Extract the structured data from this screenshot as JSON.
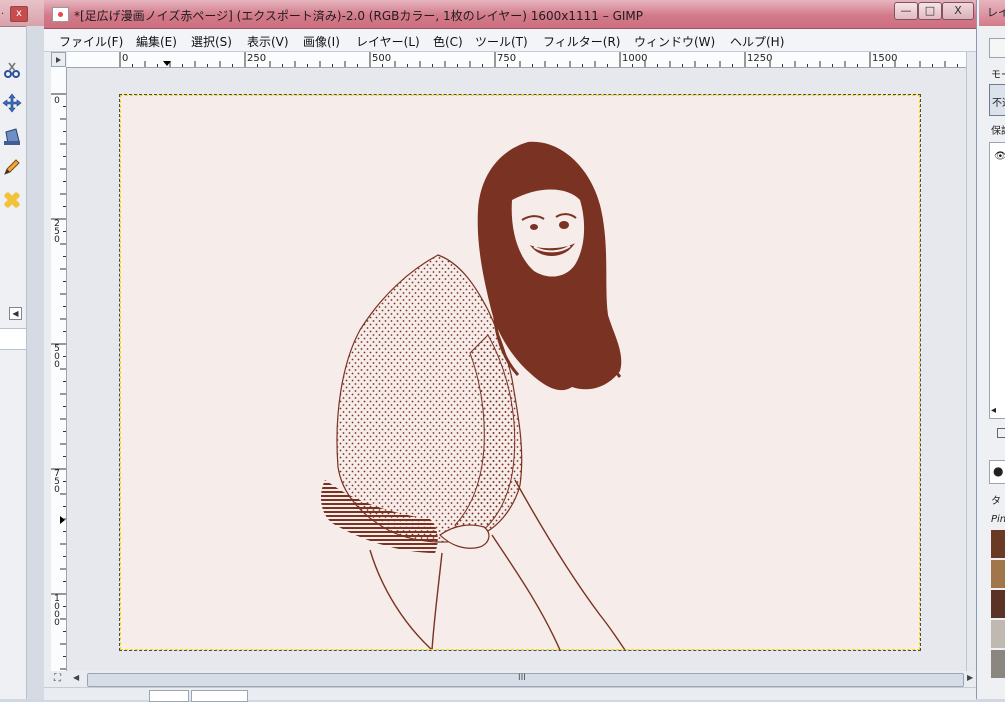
{
  "toolbox": {
    "close_label": "x",
    "tools": [
      "scissors-select-icon",
      "move-tool-icon",
      "bucket-fill-icon",
      "pencil-icon",
      "heal-icon"
    ]
  },
  "window": {
    "title": "*[足広げ漫画ノイズ赤ページ] (エクスポート済み)-2.0 (RGBカラー, 1枚のレイヤー) 1600x1111 – GIMP",
    "minimize_label": "—",
    "maximize_label": "□",
    "close_label": "X"
  },
  "menu": {
    "items": [
      "ファイル(F)",
      "編集(E)",
      "選択(S)",
      "表示(V)",
      "画像(I)",
      "レイヤー(L)",
      "色(C)",
      "ツール(T)",
      "フィルター(R)",
      "ウィンドウ(W)",
      "ヘルプ(H)"
    ]
  },
  "ruler": {
    "h_labels": [
      "0",
      "250",
      "500",
      "750",
      "1000",
      "1250",
      "1500"
    ],
    "v_labels": [
      "0",
      "250",
      "500",
      "750",
      "1000"
    ]
  },
  "image": {
    "description_color": "#7a3222",
    "background": "#f6ecea"
  },
  "statusbar": {
    "scroll_grip": "III"
  },
  "dock": {
    "title": "レイ",
    "mode_label": "モー",
    "mode_value": "不透",
    "lock_label": "保護",
    "tag_placeholder": "タ",
    "brush_name": "Pin"
  }
}
